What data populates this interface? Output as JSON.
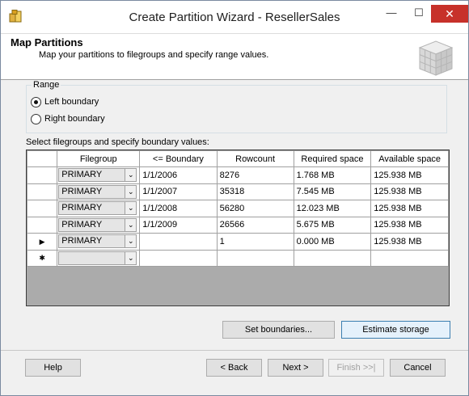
{
  "window": {
    "title": "Create Partition Wizard - ResellerSales",
    "controls": {
      "minimize": "—",
      "maximize": "☐",
      "close": "✕"
    }
  },
  "header": {
    "title": "Map Partitions",
    "subtitle": "Map your partitions to filegroups and specify range values."
  },
  "range": {
    "label": "Range",
    "options": [
      {
        "label": "Left boundary",
        "checked": true
      },
      {
        "label": "Right boundary",
        "checked": false
      }
    ]
  },
  "grid": {
    "caption": "Select filegroups and specify boundary values:",
    "columns": [
      "Filegroup",
      "<= Boundary",
      "Rowcount",
      "Required space",
      "Available space"
    ],
    "rows": [
      {
        "indicator": "",
        "filegroup": "PRIMARY",
        "boundary": "1/1/2006",
        "rowcount": "8276",
        "required": "1.768 MB",
        "available": "125.938 MB"
      },
      {
        "indicator": "",
        "filegroup": "PRIMARY",
        "boundary": "1/1/2007",
        "rowcount": "35318",
        "required": "7.545 MB",
        "available": "125.938 MB"
      },
      {
        "indicator": "",
        "filegroup": "PRIMARY",
        "boundary": "1/1/2008",
        "rowcount": "56280",
        "required": "12.023 MB",
        "available": "125.938 MB"
      },
      {
        "indicator": "",
        "filegroup": "PRIMARY",
        "boundary": "1/1/2009",
        "rowcount": "26566",
        "required": "5.675 MB",
        "available": "125.938 MB"
      },
      {
        "indicator": "▶",
        "filegroup": "PRIMARY",
        "boundary": "",
        "rowcount": "1",
        "required": "0.000 MB",
        "available": "125.938 MB"
      },
      {
        "indicator": "✱",
        "filegroup": "",
        "boundary": "",
        "rowcount": "",
        "required": "",
        "available": ""
      }
    ]
  },
  "buttons": {
    "set_boundaries": "Set boundaries...",
    "estimate_storage": "Estimate storage",
    "help": "Help",
    "back": "< Back",
    "next": "Next >",
    "finish": "Finish >>|",
    "cancel": "Cancel"
  },
  "colors": {
    "close_button": "#c7312a",
    "focus_border": "#3c7fb1"
  }
}
